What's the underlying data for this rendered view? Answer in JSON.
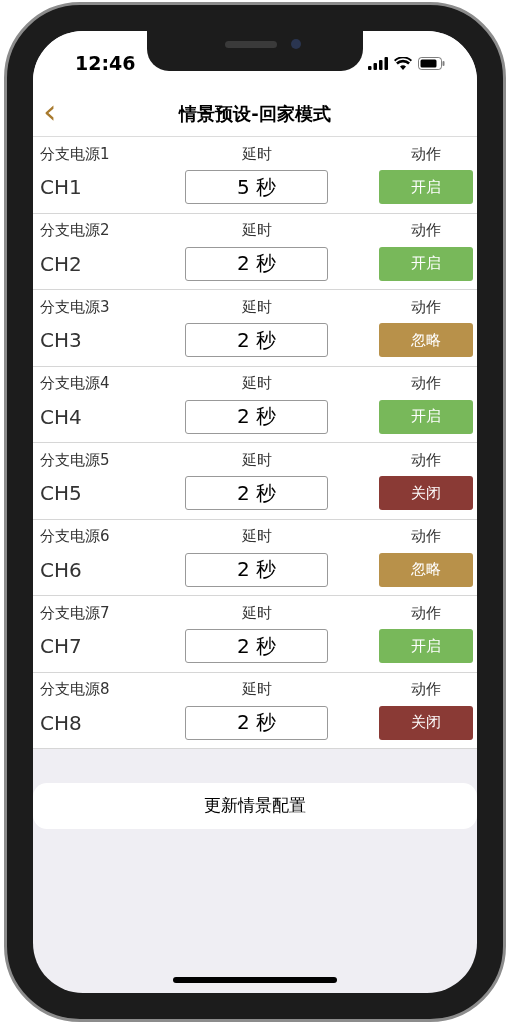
{
  "status_bar": {
    "time": "12:46"
  },
  "nav": {
    "back": "‹",
    "title": "情景预设-回家模式"
  },
  "channels": [
    {
      "label": "分支电源1",
      "delay_label": "延时",
      "action_label": "动作",
      "channel": "CH1",
      "delay": "5 秒",
      "action": {
        "label": "开启",
        "kind": "on"
      }
    },
    {
      "label": "分支电源2",
      "delay_label": "延时",
      "action_label": "动作",
      "channel": "CH2",
      "delay": "2 秒",
      "action": {
        "label": "开启",
        "kind": "on"
      }
    },
    {
      "label": "分支电源3",
      "delay_label": "延时",
      "action_label": "动作",
      "channel": "CH3",
      "delay": "2 秒",
      "action": {
        "label": "忽略",
        "kind": "ignore"
      }
    },
    {
      "label": "分支电源4",
      "delay_label": "延时",
      "action_label": "动作",
      "channel": "CH4",
      "delay": "2 秒",
      "action": {
        "label": "开启",
        "kind": "on"
      }
    },
    {
      "label": "分支电源5",
      "delay_label": "延时",
      "action_label": "动作",
      "channel": "CH5",
      "delay": "2 秒",
      "action": {
        "label": "关闭",
        "kind": "off"
      }
    },
    {
      "label": "分支电源6",
      "delay_label": "延时",
      "action_label": "动作",
      "channel": "CH6",
      "delay": "2 秒",
      "action": {
        "label": "忽略",
        "kind": "ignore"
      }
    },
    {
      "label": "分支电源7",
      "delay_label": "延时",
      "action_label": "动作",
      "channel": "CH7",
      "delay": "2 秒",
      "action": {
        "label": "开启",
        "kind": "on"
      }
    },
    {
      "label": "分支电源8",
      "delay_label": "延时",
      "action_label": "动作",
      "channel": "CH8",
      "delay": "2 秒",
      "action": {
        "label": "关闭",
        "kind": "off"
      }
    }
  ],
  "update_button": "更新情景配置"
}
